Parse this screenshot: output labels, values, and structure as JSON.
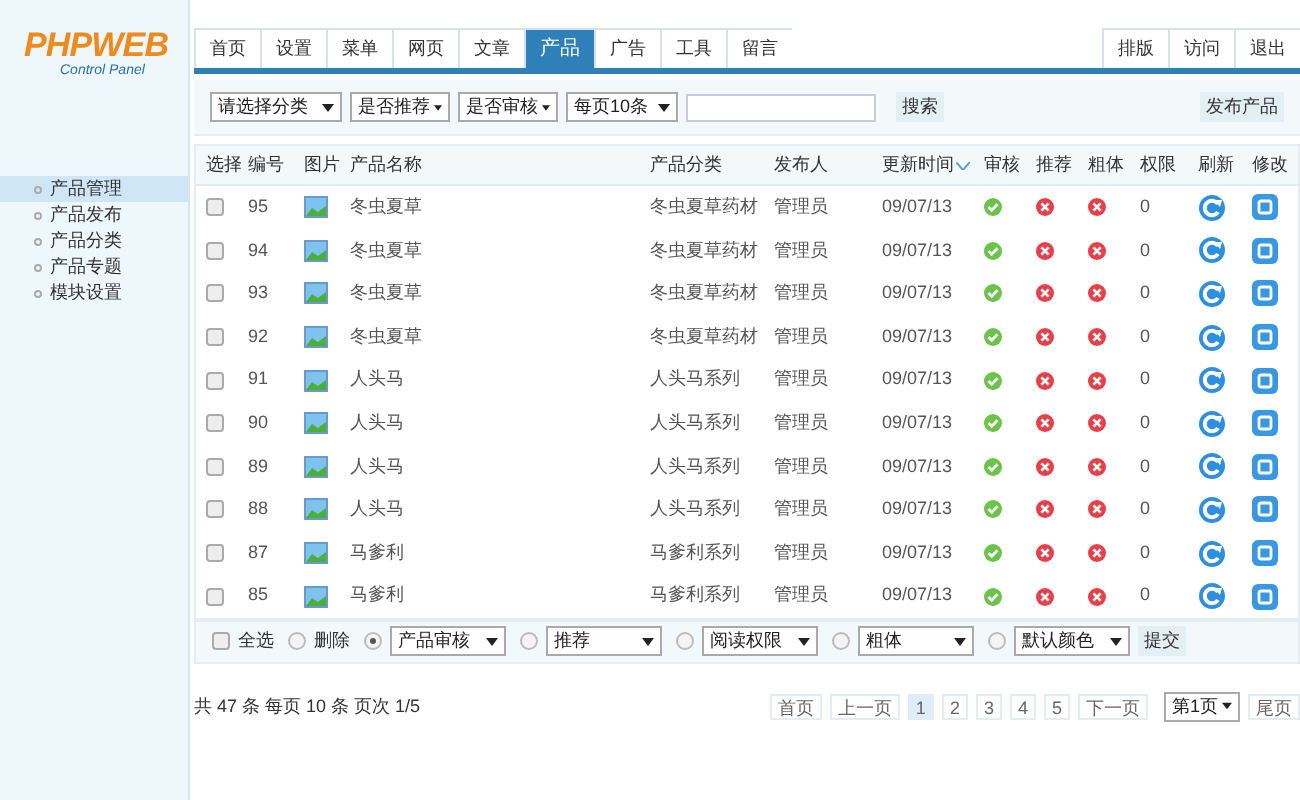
{
  "logo": {
    "brand": "PHPWEB",
    "subtitle": "Control Panel"
  },
  "tabs": [
    {
      "label": "首页",
      "selected": false
    },
    {
      "label": "设置",
      "selected": false
    },
    {
      "label": "菜单",
      "selected": false
    },
    {
      "label": "网页",
      "selected": false
    },
    {
      "label": "文章",
      "selected": false
    },
    {
      "label": "产品",
      "selected": true
    },
    {
      "label": "广告",
      "selected": false
    },
    {
      "label": "工具",
      "selected": false
    },
    {
      "label": "留言",
      "selected": false
    }
  ],
  "right_tabs": [
    "排版",
    "访问",
    "退出"
  ],
  "sidebar": {
    "items": [
      {
        "label": "产品管理",
        "selected": true
      },
      {
        "label": "产品发布",
        "selected": false
      },
      {
        "label": "产品分类",
        "selected": false
      },
      {
        "label": "产品专题",
        "selected": false
      },
      {
        "label": "模块设置",
        "selected": false
      }
    ]
  },
  "filters": [
    "请选择分类",
    "是否推荐",
    "是否审核",
    "每页10条"
  ],
  "search_button": "搜索",
  "publish_button": "发布产品",
  "table": {
    "columns": [
      "选择",
      "编号",
      "图片",
      "产品名称",
      "产品分类",
      "发布人",
      "更新时间",
      "审核",
      "推荐",
      "粗体",
      "权限",
      "刷新",
      "修改"
    ],
    "rows": [
      {
        "checked": false,
        "id": "95",
        "name": "冬虫夏草",
        "category": "冬虫夏草药材",
        "publisher": "管理员",
        "date": "09/07/13",
        "audited": true,
        "recommended": false,
        "bold": false,
        "permission": "0"
      },
      {
        "checked": false,
        "id": "94",
        "name": "冬虫夏草",
        "category": "冬虫夏草药材",
        "publisher": "管理员",
        "date": "09/07/13",
        "audited": true,
        "recommended": false,
        "bold": false,
        "permission": "0"
      },
      {
        "checked": false,
        "id": "93",
        "name": "冬虫夏草",
        "category": "冬虫夏草药材",
        "publisher": "管理员",
        "date": "09/07/13",
        "audited": true,
        "recommended": false,
        "bold": false,
        "permission": "0"
      },
      {
        "checked": false,
        "id": "92",
        "name": "冬虫夏草",
        "category": "冬虫夏草药材",
        "publisher": "管理员",
        "date": "09/07/13",
        "audited": true,
        "recommended": false,
        "bold": false,
        "permission": "0"
      },
      {
        "checked": false,
        "id": "91",
        "name": "人头马",
        "category": "人头马系列",
        "publisher": "管理员",
        "date": "09/07/13",
        "audited": true,
        "recommended": false,
        "bold": false,
        "permission": "0"
      },
      {
        "checked": false,
        "id": "90",
        "name": "人头马",
        "category": "人头马系列",
        "publisher": "管理员",
        "date": "09/07/13",
        "audited": true,
        "recommended": false,
        "bold": false,
        "permission": "0"
      },
      {
        "checked": false,
        "id": "89",
        "name": "人头马",
        "category": "人头马系列",
        "publisher": "管理员",
        "date": "09/07/13",
        "audited": true,
        "recommended": false,
        "bold": false,
        "permission": "0"
      },
      {
        "checked": false,
        "id": "88",
        "name": "人头马",
        "category": "人头马系列",
        "publisher": "管理员",
        "date": "09/07/13",
        "audited": true,
        "recommended": false,
        "bold": false,
        "permission": "0"
      },
      {
        "checked": false,
        "id": "87",
        "name": "马爹利",
        "category": "马爹利系列",
        "publisher": "管理员",
        "date": "09/07/13",
        "audited": true,
        "recommended": false,
        "bold": false,
        "permission": "0"
      },
      {
        "checked": false,
        "id": "85",
        "name": "马爹利",
        "category": "马爹利系列",
        "publisher": "管理员",
        "date": "09/07/13",
        "audited": true,
        "recommended": false,
        "bold": false,
        "permission": "0"
      }
    ]
  },
  "batch": {
    "select_all": {
      "label": "全选",
      "checked": false
    },
    "options": [
      {
        "kind": "radio",
        "label": "删除",
        "selected": false
      },
      {
        "kind": "select",
        "value": "产品审核",
        "selected": true
      },
      {
        "kind": "select",
        "value": "推荐",
        "selected": false
      },
      {
        "kind": "select",
        "value": "阅读权限",
        "selected": false
      },
      {
        "kind": "select",
        "value": "粗体",
        "selected": false
      },
      {
        "kind": "select",
        "value": "默认颜色",
        "selected": false
      }
    ],
    "submit": "提交"
  },
  "summary": "共 47 条 每页 10 条 页次 1/5",
  "pagination": {
    "first": "首页",
    "prev": "上一页",
    "pages": [
      {
        "label": "1",
        "selected": true
      },
      {
        "label": "2",
        "selected": false
      },
      {
        "label": "3",
        "selected": false
      },
      {
        "label": "4",
        "selected": false
      },
      {
        "label": "5",
        "selected": false
      }
    ],
    "next": "下一页",
    "jump": "第1页",
    "last": "尾页"
  }
}
